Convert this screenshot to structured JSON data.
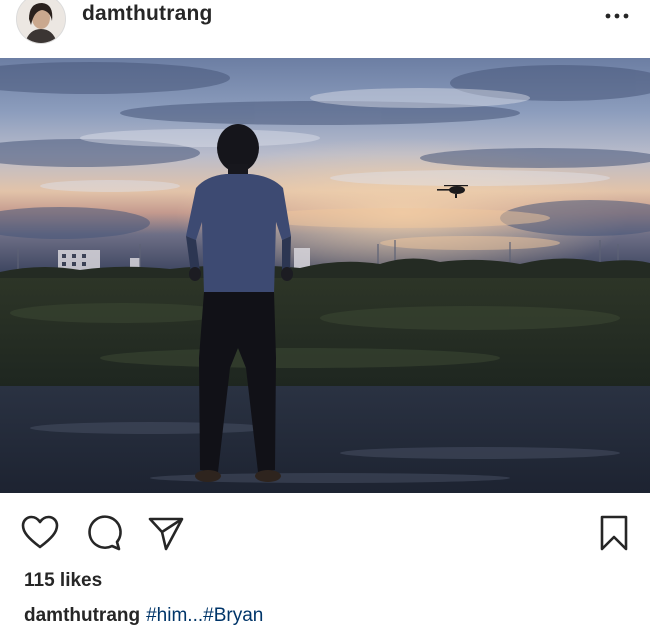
{
  "header": {
    "username": "damthutrang",
    "avatar_icon": "profile-avatar",
    "more_icon": "more-options-icon"
  },
  "photo": {
    "description_icon": "post-photo"
  },
  "actions": {
    "like_icon": "heart-icon",
    "comment_icon": "comment-icon",
    "share_icon": "share-icon",
    "save_icon": "bookmark-icon"
  },
  "likes": {
    "text": "115 likes"
  },
  "caption": {
    "username": "damthutrang",
    "text": "#him...#Bryan"
  },
  "colors": {
    "text": "#262626",
    "hashtag": "#003569",
    "background": "#ffffff"
  }
}
